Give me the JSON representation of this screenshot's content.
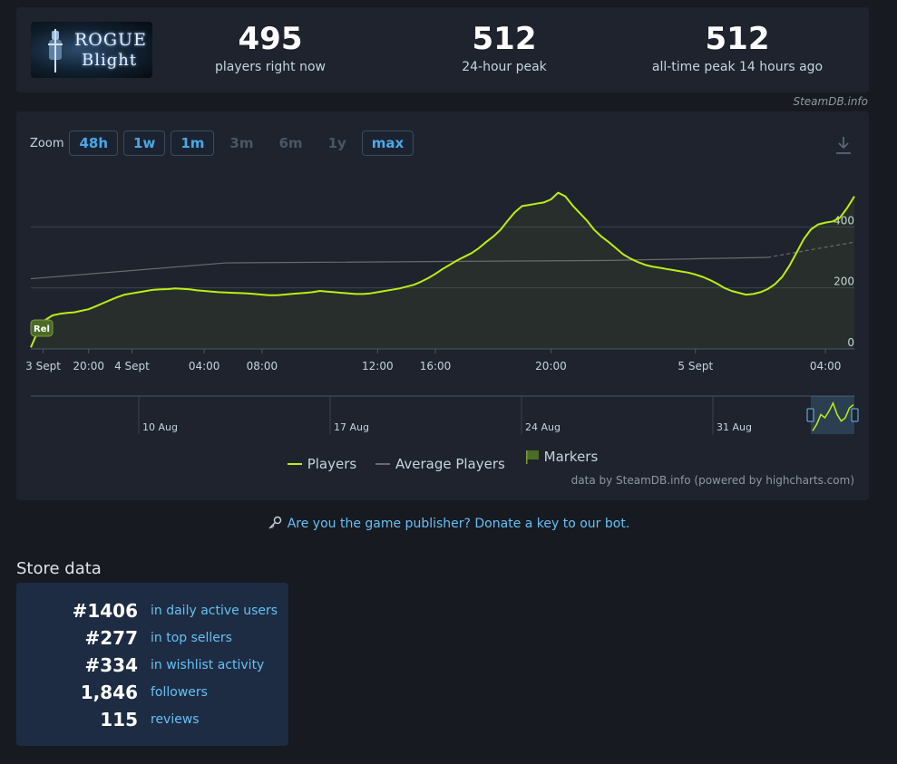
{
  "header": {
    "logo_text_line1": "ROGUE",
    "logo_text_line2": "Blight",
    "stats": [
      {
        "value": "495",
        "label": "players right now"
      },
      {
        "value": "512",
        "label": "24-hour peak"
      },
      {
        "value": "512",
        "label": "all-time peak 14 hours ago"
      }
    ],
    "credit": "SteamDB.info"
  },
  "chart": {
    "zoom_label": "Zoom",
    "zoom_buttons": [
      {
        "label": "48h",
        "enabled": true
      },
      {
        "label": "1w",
        "enabled": true
      },
      {
        "label": "1m",
        "enabled": true
      },
      {
        "label": "3m",
        "enabled": false
      },
      {
        "label": "6m",
        "enabled": false
      },
      {
        "label": "1y",
        "enabled": false
      },
      {
        "label": "max",
        "enabled": true
      }
    ],
    "download_icon": "download-icon",
    "marker_label": "Rel",
    "legend": [
      {
        "label": "Players",
        "color": "#beee11"
      },
      {
        "label": "Average Players",
        "color": "#6b6b6b"
      },
      {
        "label": "Markers",
        "color": "#4b6b26"
      }
    ],
    "navigator_labels": [
      "10 Aug",
      "17 Aug",
      "24 Aug",
      "31 Aug"
    ],
    "credit": "data by SteamDB.info (powered by highcharts.com)"
  },
  "chart_data": {
    "type": "line",
    "x_tick_labels": [
      "3 Sept",
      "20:00",
      "4 Sept",
      "04:00",
      "08:00",
      "12:00",
      "16:00",
      "20:00",
      "5 Sept",
      "04:00"
    ],
    "y_tick_labels": [
      "0",
      "200",
      "400"
    ],
    "ylim": [
      0,
      600
    ],
    "grid": true,
    "legend_position": "bottom",
    "series": [
      {
        "name": "Players",
        "color": "#beee11",
        "x_hours": [
          0,
          1,
          2,
          3,
          4,
          5,
          6,
          7,
          8,
          9,
          10,
          11,
          12,
          13,
          14,
          15,
          16,
          17,
          18,
          19,
          20,
          21,
          22,
          23,
          24,
          25,
          26,
          27,
          28,
          29,
          30,
          31,
          32,
          33,
          34,
          35,
          36,
          37,
          38,
          39,
          40,
          41,
          42,
          43,
          44,
          45,
          46,
          47,
          48,
          49,
          50,
          51,
          52,
          53,
          54,
          55,
          56,
          57,
          58,
          59,
          60,
          61,
          62,
          63,
          64,
          65,
          66,
          67,
          68,
          69,
          70,
          71,
          72,
          73,
          74,
          75,
          76,
          77,
          78,
          79,
          80,
          81,
          82,
          83,
          84,
          85,
          86,
          87,
          88,
          89,
          90,
          91,
          92,
          93,
          94,
          95,
          96,
          97,
          98,
          99,
          100,
          101,
          102,
          103,
          104,
          105,
          106,
          107,
          108,
          109,
          110,
          111,
          112,
          113,
          114
        ],
        "values": [
          5,
          60,
          95,
          110,
          115,
          118,
          120,
          125,
          130,
          140,
          150,
          160,
          170,
          178,
          182,
          186,
          190,
          194,
          195,
          196,
          198,
          197,
          195,
          192,
          190,
          188,
          186,
          185,
          184,
          183,
          182,
          180,
          178,
          176,
          176,
          178,
          180,
          182,
          184,
          186,
          190,
          188,
          186,
          184,
          182,
          180,
          180,
          182,
          186,
          190,
          194,
          198,
          204,
          210,
          220,
          232,
          246,
          262,
          276,
          290,
          302,
          314,
          330,
          350,
          368,
          390,
          420,
          448,
          468,
          472,
          476,
          480,
          490,
          512,
          500,
          470,
          445,
          420,
          390,
          368,
          350,
          330,
          310,
          296,
          285,
          276,
          270,
          266,
          262,
          258,
          254,
          250,
          244,
          236,
          226,
          214,
          200,
          190,
          184,
          178,
          180,
          186,
          196,
          212,
          236,
          272,
          316,
          360,
          392,
          408,
          414,
          418,
          430,
          462,
          500
        ],
        "note": "hourly samples from 3 Sept 18:00"
      },
      {
        "name": "Average Players",
        "color": "#6b6b6b",
        "x_hours": [
          0,
          27,
          80,
          102,
          114
        ],
        "values": [
          230,
          282,
          290,
          300,
          350
        ]
      }
    ]
  },
  "publisher_link": "Are you the game publisher? Donate a key to our bot.",
  "store": {
    "title": "Store data",
    "rows": [
      {
        "value": "#1406",
        "label": "in daily active users"
      },
      {
        "value": "#277",
        "label": "in top sellers"
      },
      {
        "value": "#334",
        "label": "in wishlist activity"
      },
      {
        "value": "1,846",
        "label": "followers"
      },
      {
        "value": "115",
        "label": "reviews"
      }
    ]
  }
}
